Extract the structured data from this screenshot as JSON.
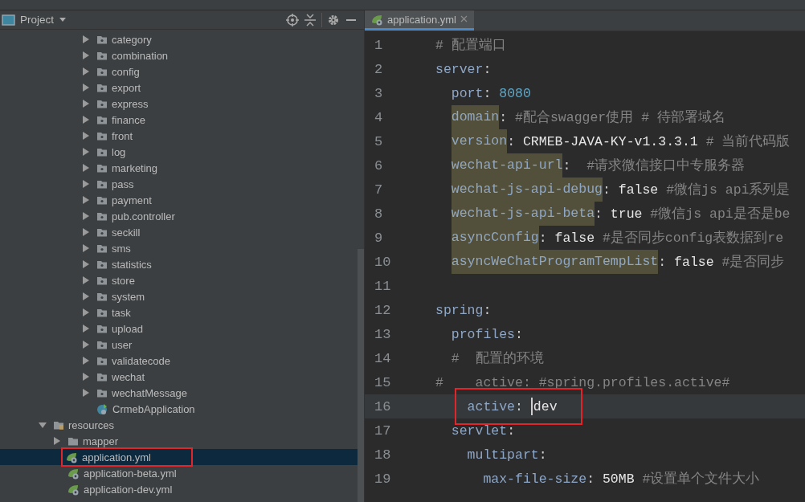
{
  "project_panel": {
    "title": "Project",
    "tree": [
      {
        "children": [
          {
            "children": [
              {
                "children": [
                  {
                    "label": "category",
                    "kind": "package",
                    "expanded": false,
                    "selected": false,
                    "boxed": false
                  },
                  {
                    "label": "combination",
                    "kind": "package",
                    "expanded": false,
                    "selected": false,
                    "boxed": false
                  },
                  {
                    "label": "config",
                    "kind": "package",
                    "expanded": false,
                    "selected": false,
                    "boxed": false
                  },
                  {
                    "label": "export",
                    "kind": "package",
                    "expanded": false,
                    "selected": false,
                    "boxed": false
                  },
                  {
                    "label": "express",
                    "kind": "package",
                    "expanded": false,
                    "selected": false,
                    "boxed": false
                  },
                  {
                    "label": "finance",
                    "kind": "package",
                    "expanded": false,
                    "selected": false,
                    "boxed": false
                  },
                  {
                    "label": "front",
                    "kind": "package",
                    "expanded": false,
                    "selected": false,
                    "boxed": false
                  },
                  {
                    "label": "log",
                    "kind": "package",
                    "expanded": false,
                    "selected": false,
                    "boxed": false
                  },
                  {
                    "label": "marketing",
                    "kind": "package",
                    "expanded": false,
                    "selected": false,
                    "boxed": false
                  },
                  {
                    "label": "pass",
                    "kind": "package",
                    "expanded": false,
                    "selected": false,
                    "boxed": false
                  },
                  {
                    "label": "payment",
                    "kind": "package",
                    "expanded": false,
                    "selected": false,
                    "boxed": false
                  },
                  {
                    "label": "pub.controller",
                    "kind": "package",
                    "expanded": false,
                    "selected": false,
                    "boxed": false
                  },
                  {
                    "label": "seckill",
                    "kind": "package",
                    "expanded": false,
                    "selected": false,
                    "boxed": false
                  },
                  {
                    "label": "sms",
                    "kind": "package",
                    "expanded": false,
                    "selected": false,
                    "boxed": false
                  },
                  {
                    "label": "statistics",
                    "kind": "package",
                    "expanded": false,
                    "selected": false,
                    "boxed": false
                  },
                  {
                    "label": "store",
                    "kind": "package",
                    "expanded": false,
                    "selected": false,
                    "boxed": false
                  },
                  {
                    "label": "system",
                    "kind": "package",
                    "expanded": false,
                    "selected": false,
                    "boxed": false
                  },
                  {
                    "label": "task",
                    "kind": "package",
                    "expanded": false,
                    "selected": false,
                    "boxed": false
                  },
                  {
                    "label": "upload",
                    "kind": "package",
                    "expanded": false,
                    "selected": false,
                    "boxed": false
                  },
                  {
                    "label": "user",
                    "kind": "package",
                    "expanded": false,
                    "selected": false,
                    "boxed": false
                  },
                  {
                    "label": "validatecode",
                    "kind": "package",
                    "expanded": false,
                    "selected": false,
                    "boxed": false
                  },
                  {
                    "label": "wechat",
                    "kind": "package",
                    "expanded": false,
                    "selected": false,
                    "boxed": false
                  },
                  {
                    "label": "wechatMessage",
                    "kind": "package",
                    "expanded": false,
                    "selected": false,
                    "boxed": false
                  },
                  {
                    "label": "CrmebApplication",
                    "kind": "class",
                    "selected": false,
                    "boxed": false
                  }
                ]
              }
            ]
          }
        ]
      },
      {
        "label": "resources",
        "kind": "resources",
        "expanded": true,
        "selected": false,
        "boxed": false,
        "children": [
          {
            "label": "mapper",
            "kind": "folder",
            "expanded": false,
            "selected": false,
            "boxed": false
          },
          {
            "label": "application.yml",
            "kind": "yaml",
            "selected": true,
            "boxed": true
          },
          {
            "label": "application-beta.yml",
            "kind": "yaml",
            "selected": false,
            "boxed": false
          },
          {
            "label": "application-dev.yml",
            "kind": "yaml",
            "selected": false,
            "boxed": false
          }
        ]
      }
    ]
  },
  "editor": {
    "tabs": [
      {
        "label": "application.yml",
        "selected": true
      }
    ],
    "lines": [
      {
        "number": "1",
        "current": false,
        "boxed": false,
        "tokens": [
          {
            "kind": "comment",
            "text": "# 配置端口"
          }
        ]
      },
      {
        "number": "2",
        "current": false,
        "boxed": false,
        "tokens": [
          {
            "kind": "key",
            "text": "server"
          },
          {
            "kind": "punct",
            "text": ":"
          }
        ]
      },
      {
        "number": "3",
        "current": false,
        "boxed": false,
        "tokens": [
          {
            "kind": "key",
            "text": "  port"
          },
          {
            "kind": "punct",
            "text": ": "
          },
          {
            "kind": "number",
            "text": "8080"
          }
        ]
      },
      {
        "number": "4",
        "current": false,
        "boxed": false,
        "tokens": [
          {
            "kind": "marked-key",
            "text": "  domain"
          },
          {
            "kind": "punct",
            "text": ": "
          },
          {
            "kind": "comment",
            "text": "#配合swagger使用 # 待部署域名"
          }
        ]
      },
      {
        "number": "5",
        "current": false,
        "boxed": false,
        "tokens": [
          {
            "kind": "marked-key",
            "text": "  version"
          },
          {
            "kind": "punct",
            "text": ": "
          },
          {
            "kind": "value",
            "text": "CRMEB-JAVA-KY-v1.3.3.1"
          },
          {
            "kind": "comment",
            "text": " # 当前代码版"
          }
        ]
      },
      {
        "number": "6",
        "current": false,
        "boxed": false,
        "tokens": [
          {
            "kind": "marked-key",
            "text": "  wechat-api-url"
          },
          {
            "kind": "punct",
            "text": ":  "
          },
          {
            "kind": "comment",
            "text": "#请求微信接口中专服务器"
          }
        ]
      },
      {
        "number": "7",
        "current": false,
        "boxed": false,
        "tokens": [
          {
            "kind": "marked-key",
            "text": "  wechat-js-api-debug"
          },
          {
            "kind": "punct",
            "text": ": "
          },
          {
            "kind": "value",
            "text": "false"
          },
          {
            "kind": "comment",
            "text": " #微信js api系列是"
          }
        ]
      },
      {
        "number": "8",
        "current": false,
        "boxed": false,
        "tokens": [
          {
            "kind": "marked-key",
            "text": "  wechat-js-api-beta"
          },
          {
            "kind": "punct",
            "text": ": "
          },
          {
            "kind": "value",
            "text": "true"
          },
          {
            "kind": "comment",
            "text": " #微信js api是否是be"
          }
        ]
      },
      {
        "number": "9",
        "current": false,
        "boxed": false,
        "tokens": [
          {
            "kind": "marked-key",
            "text": "  asyncConfig"
          },
          {
            "kind": "punct",
            "text": ": "
          },
          {
            "kind": "value",
            "text": "false"
          },
          {
            "kind": "comment",
            "text": " #是否同步config表数据到re"
          }
        ]
      },
      {
        "number": "10",
        "current": false,
        "boxed": false,
        "tokens": [
          {
            "kind": "marked-key",
            "text": "  asyncWeChatProgramTempList"
          },
          {
            "kind": "punct",
            "text": ": "
          },
          {
            "kind": "value",
            "text": "false"
          },
          {
            "kind": "comment",
            "text": " #是否同步"
          }
        ]
      },
      {
        "number": "11",
        "current": false,
        "boxed": false
      },
      {
        "number": "12",
        "current": false,
        "boxed": false,
        "tokens": [
          {
            "kind": "key",
            "text": "spring"
          },
          {
            "kind": "punct",
            "text": ":"
          }
        ]
      },
      {
        "number": "13",
        "current": false,
        "boxed": false,
        "tokens": [
          {
            "kind": "key",
            "text": "  profiles"
          },
          {
            "kind": "punct",
            "text": ":"
          }
        ]
      },
      {
        "number": "14",
        "current": false,
        "boxed": false,
        "tokens": [
          {
            "kind": "comment",
            "text": "  #  配置的环境"
          }
        ]
      },
      {
        "number": "15",
        "current": false,
        "boxed": false,
        "tokens": [
          {
            "kind": "comment",
            "text": "#    active: #spring.profiles.active#"
          }
        ]
      },
      {
        "number": "16",
        "current": true,
        "boxed": true,
        "tokens": [
          {
            "kind": "key",
            "text": "    active"
          },
          {
            "kind": "punct",
            "text": ": "
          },
          {
            "kind": "caret"
          },
          {
            "kind": "value",
            "text": "dev"
          }
        ]
      },
      {
        "number": "17",
        "current": false,
        "boxed": false,
        "tokens": [
          {
            "kind": "key",
            "text": "  servlet"
          },
          {
            "kind": "punct",
            "text": ":"
          }
        ]
      },
      {
        "number": "18",
        "current": false,
        "boxed": false,
        "tokens": [
          {
            "kind": "key",
            "text": "    multipart"
          },
          {
            "kind": "punct",
            "text": ":"
          }
        ]
      },
      {
        "number": "19",
        "current": false,
        "boxed": false,
        "tokens": [
          {
            "kind": "key",
            "text": "      max-file-size"
          },
          {
            "kind": "punct",
            "text": ": "
          },
          {
            "kind": "value",
            "text": "50MB"
          },
          {
            "kind": "comment",
            "text": " #设置单个文件大小"
          }
        ]
      }
    ]
  }
}
